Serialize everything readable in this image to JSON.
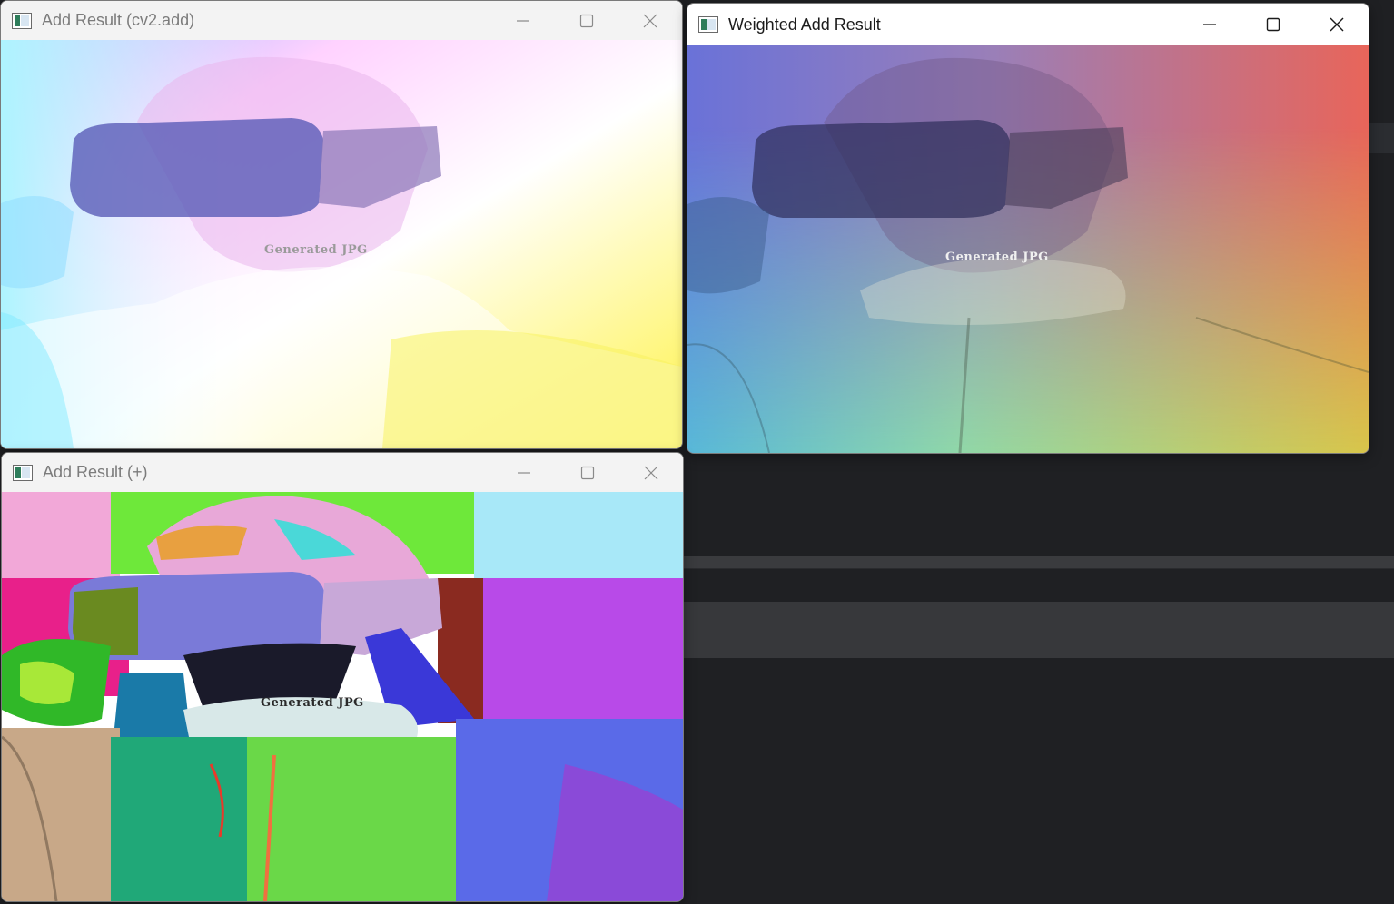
{
  "windows": {
    "add_cv2": {
      "title": "Add Result (cv2.add)",
      "overlay_text": "Generated JPG",
      "overlay_color": "#8a8a8a"
    },
    "weighted": {
      "title": "Weighted Add Result",
      "overlay_text": "Generated JPG",
      "overlay_color": "#f2f2f2"
    },
    "add_plus": {
      "title": "Add Result (+)",
      "overlay_text": "Generated JPG",
      "overlay_color": "#2a2a2a"
    }
  },
  "controls": {
    "minimize_icon": "minimize-icon",
    "maximize_icon": "maximize-icon",
    "close_icon": "close-icon"
  },
  "colors": {
    "desktop_bg": "#1f2023",
    "titlebar_inactive": "#f3f3f3",
    "titlebar_active": "#ffffff"
  }
}
